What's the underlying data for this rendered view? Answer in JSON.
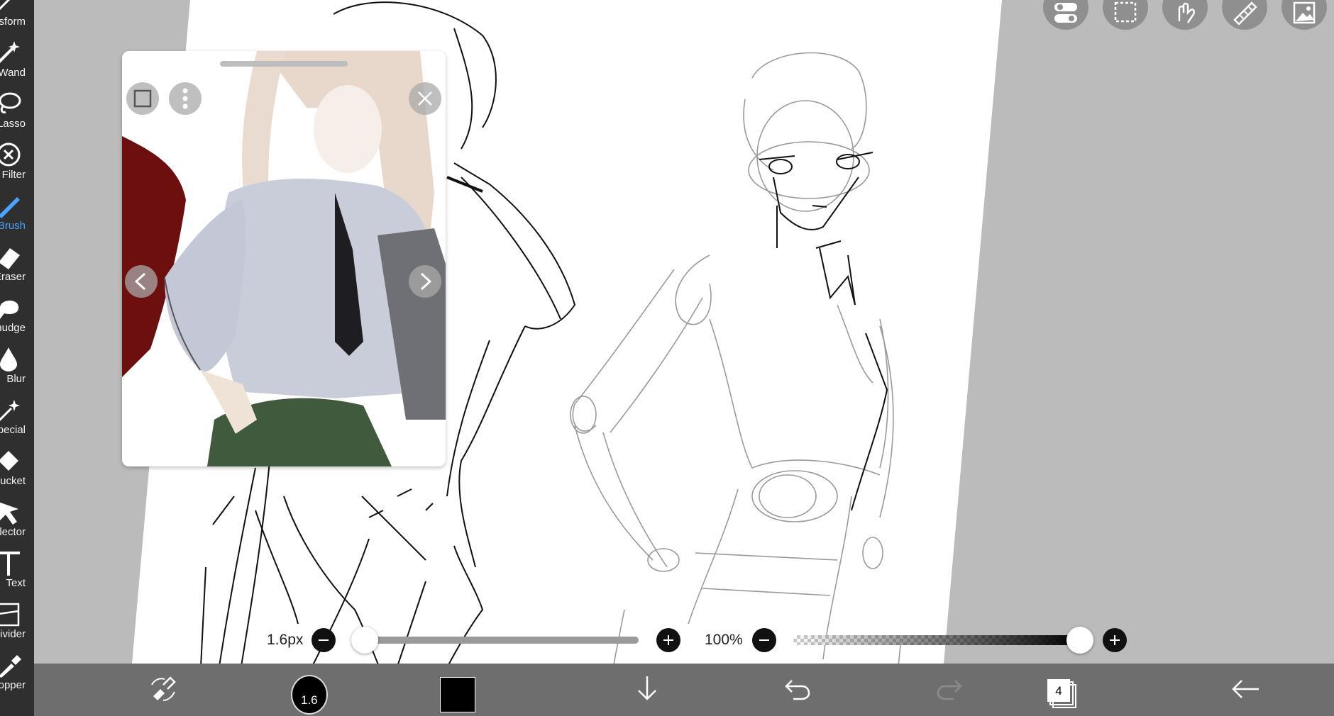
{
  "tools": [
    {
      "label": "Transform",
      "icon": "transform-icon",
      "active": false
    },
    {
      "label": "Magic Wand",
      "icon": "magic-wand-icon",
      "active": false
    },
    {
      "label": "Lasso",
      "icon": "lasso-icon",
      "active": false
    },
    {
      "label": "Filter",
      "icon": "filter-icon",
      "active": false
    },
    {
      "label": "Brush",
      "icon": "brush-icon",
      "active": true
    },
    {
      "label": "Eraser",
      "icon": "eraser-icon",
      "active": false
    },
    {
      "label": "Smudge",
      "icon": "smudge-icon",
      "active": false
    },
    {
      "label": "Blur",
      "icon": "blur-icon",
      "active": false
    },
    {
      "label": "Special",
      "icon": "special-icon",
      "active": false
    },
    {
      "label": "Bucket",
      "icon": "bucket-icon",
      "active": false
    },
    {
      "label": "Selector",
      "icon": "selector-icon",
      "active": false
    },
    {
      "label": "Text",
      "icon": "text-icon",
      "active": false
    },
    {
      "label": "Frame Divider",
      "icon": "frame-divider-icon",
      "active": false
    },
    {
      "label": "Eyedropper",
      "icon": "eyedropper-icon",
      "active": false
    }
  ],
  "top_buttons": [
    "toggle-icon",
    "selection-icon",
    "hand-gesture-icon",
    "ruler-icon",
    "material-icon"
  ],
  "reference": {
    "icons": [
      "crop-icon",
      "more-vertical-icon",
      "close-icon",
      "chevron-left-icon",
      "chevron-right-icon"
    ]
  },
  "brush_size": {
    "label": "1.6px",
    "value": 1.6,
    "fraction": 0.03
  },
  "opacity": {
    "label": "100%",
    "value": 100,
    "fraction": 1.0
  },
  "bottom": {
    "brush_size_badge": "1.6",
    "current_color": "#000000",
    "layer_count": "4",
    "icons": [
      "brush-eraser-swap-icon",
      "brush-preview-icon",
      "color-swatch-icon",
      "download-icon",
      "undo-icon",
      "redo-icon",
      "layers-icon",
      "back-arrow-icon"
    ]
  },
  "colors": {
    "accent": "#4aa3ff",
    "toolbar": "#2f2f2f",
    "bottom_bar": "#6e6e6e",
    "workspace": "#bbbbbb"
  }
}
